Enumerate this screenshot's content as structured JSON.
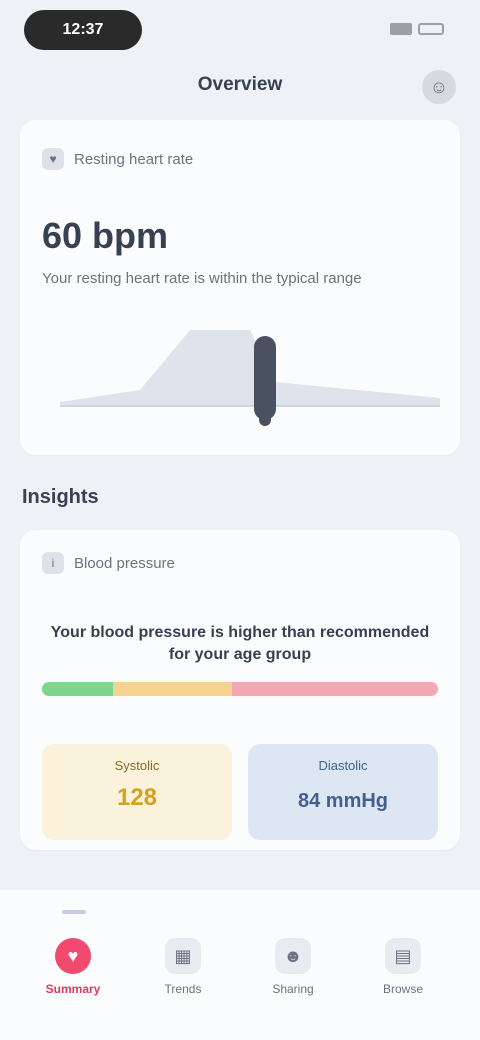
{
  "status_bar": {
    "time": "12:37",
    "icons": [
      "signal-icon",
      "battery-icon"
    ]
  },
  "header": {
    "title": "Overview",
    "icon": "profile-icon"
  },
  "summary_card": {
    "heading_icon": "heart-icon",
    "heading": "Resting heart rate",
    "value": "60 bpm",
    "description": "Your resting heart rate is within the typical range"
  },
  "section": {
    "title": "Insights"
  },
  "insight_card": {
    "heading_icon": "info-icon",
    "heading": "Blood pressure",
    "text": "Your blood pressure is higher than recommended for your age group",
    "range_colors": [
      "#7cd68d",
      "#f6d48f",
      "#f6a7b4"
    ],
    "range_fractions": [
      0.18,
      0.3,
      0.52
    ],
    "tile_left": {
      "label": "Systolic",
      "value": "128"
    },
    "tile_right": {
      "label": "Diastolic",
      "value": "84 mmHg"
    }
  },
  "bottom_nav": {
    "items": [
      {
        "label": "Summary",
        "icon": "heart-icon",
        "active": true
      },
      {
        "label": "Trends",
        "icon": "chart-icon",
        "active": false
      },
      {
        "label": "Sharing",
        "icon": "people-icon",
        "active": false
      },
      {
        "label": "Browse",
        "icon": "grid-icon",
        "active": false
      }
    ]
  },
  "colors": {
    "accent": "#f14a6e",
    "background": "#eef2f6",
    "card": "#fbfcfd"
  }
}
